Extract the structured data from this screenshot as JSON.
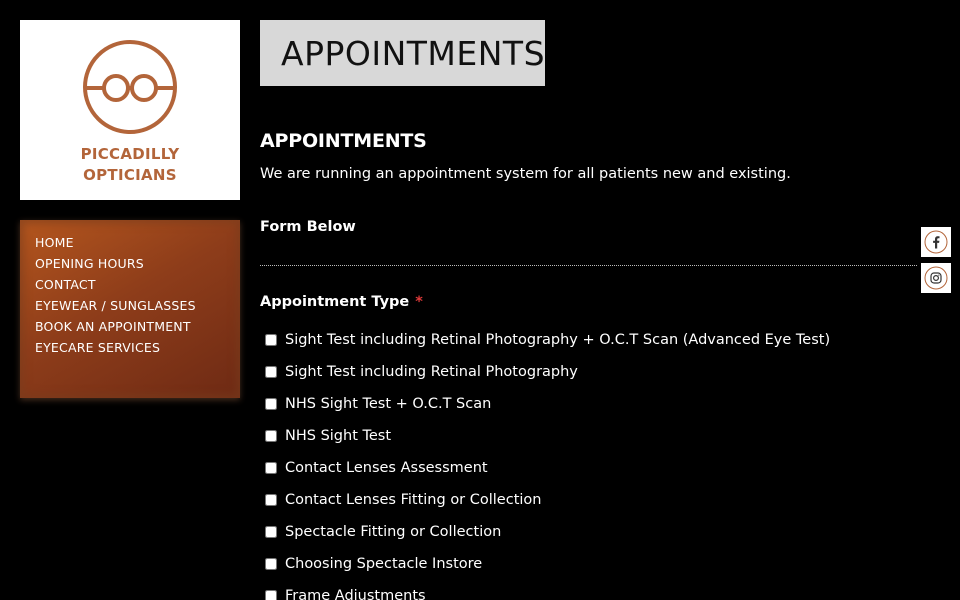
{
  "logo": {
    "line1": "PICCADILLY",
    "line2": "OPTICIANS",
    "brand_color": "#b3653a",
    "icon": "glasses-icon"
  },
  "nav": {
    "items": [
      {
        "label": "HOME"
      },
      {
        "label": "OPENING HOURS"
      },
      {
        "label": "CONTACT"
      },
      {
        "label": "EYEWEAR / SUNGLASSES"
      },
      {
        "label": "BOOK AN APPOINTMENT"
      },
      {
        "label": "EYECARE SERVICES"
      }
    ]
  },
  "banner": {
    "title": "APPOINTMENTS"
  },
  "content": {
    "heading": "APPOINTMENTS",
    "intro": "We are running an appointment system for all patients new and existing.",
    "form_label": "Form Below"
  },
  "form": {
    "field_label": "Appointment Type",
    "required_mark": "*",
    "options": [
      {
        "label": "Sight Test including Retinal Photography + O.C.T Scan (Advanced Eye Test)",
        "checked": false
      },
      {
        "label": "Sight Test including Retinal Photography",
        "checked": false
      },
      {
        "label": "NHS Sight Test + O.C.T Scan",
        "checked": false
      },
      {
        "label": "NHS Sight Test",
        "checked": false
      },
      {
        "label": "Contact Lenses Assessment",
        "checked": false
      },
      {
        "label": "Contact Lenses Fitting or Collection",
        "checked": false
      },
      {
        "label": "Spectacle Fitting or Collection",
        "checked": false
      },
      {
        "label": "Choosing Spectacle Instore",
        "checked": false
      },
      {
        "label": "Frame Adjustments",
        "checked": false
      }
    ]
  },
  "social": [
    {
      "icon": "facebook-icon"
    },
    {
      "icon": "instagram-icon"
    }
  ]
}
